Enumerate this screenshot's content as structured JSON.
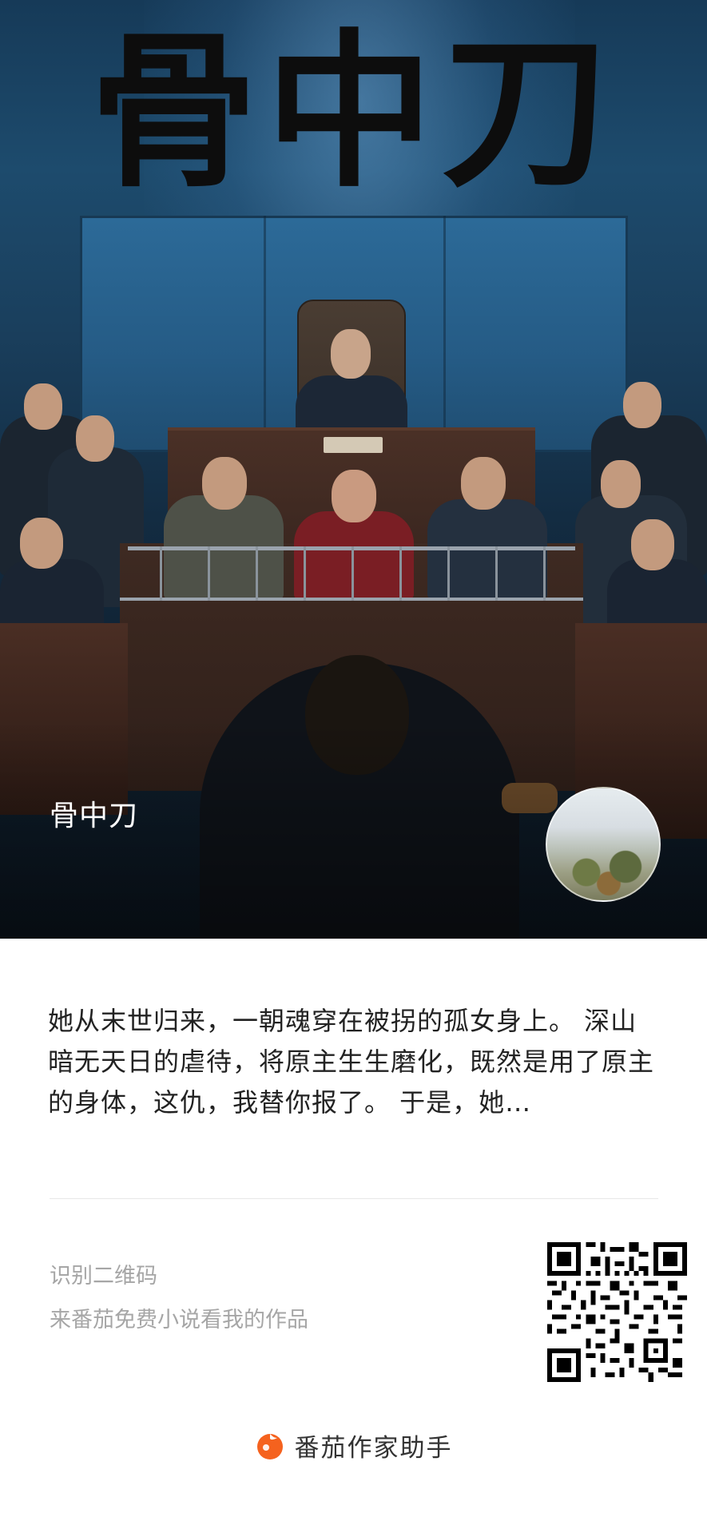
{
  "cover": {
    "title_art": "骨中刀",
    "book_name": "骨中刀"
  },
  "description": "她从末世归来，一朝魂穿在被拐的孤女身上。 深山暗无天日的虐待，将原主生生磨化，既然是用了原主的身体，这仇，我替你报了。 于是，她…",
  "qr": {
    "caption_line1": "识别二维码",
    "caption_line2": "来番茄免费小说看我的作品"
  },
  "footer": {
    "brand_name": "番茄作家助手",
    "brand_color": "#f5621e"
  }
}
